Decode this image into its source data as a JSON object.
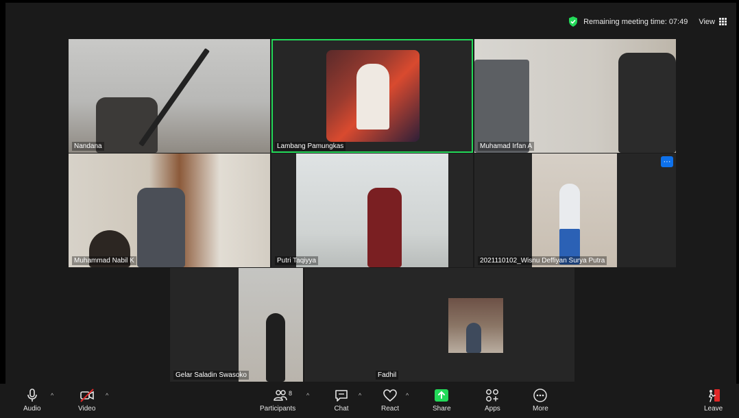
{
  "header": {
    "remaining_time_label": "Remaining meeting time: 07:49",
    "view_label": "View"
  },
  "participants": [
    {
      "name": "Nandana"
    },
    {
      "name": "Lambang Pamungkas",
      "active_speaker": true
    },
    {
      "name": "Muhamad Irfan A"
    },
    {
      "name": "Muhammad Nabil K"
    },
    {
      "name": "Putri Taqiyya"
    },
    {
      "name": "2021110102_Wisnu Deffiyan Surya Putra"
    },
    {
      "name": "Gelar Saladin Swasoko"
    },
    {
      "name": "Fadhil"
    }
  ],
  "toolbar": {
    "audio": "Audio",
    "video": "Video",
    "participants": "Participants",
    "participants_count": "8",
    "chat": "Chat",
    "react": "React",
    "share": "Share",
    "apps": "Apps",
    "more": "More",
    "leave": "Leave"
  },
  "colors": {
    "active_outline": "#23d959",
    "share_green": "#23d959",
    "leave_red": "#e02828",
    "menu_blue": "#0e71eb"
  }
}
